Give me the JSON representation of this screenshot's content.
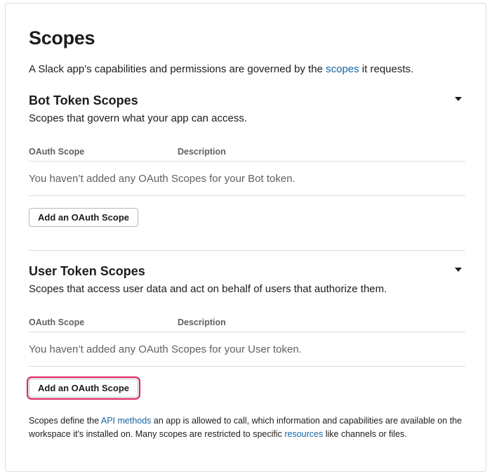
{
  "page": {
    "title": "Scopes",
    "intro_before": "A Slack app's capabilities and permissions are governed by the ",
    "intro_link": "scopes",
    "intro_after": " it requests."
  },
  "bot_section": {
    "title": "Bot Token Scopes",
    "description": "Scopes that govern what your app can access.",
    "col_scope": "OAuth Scope",
    "col_description": "Description",
    "empty_text": "You haven’t added any OAuth Scopes for your Bot token.",
    "add_button": "Add an OAuth Scope",
    "toggle_icon": "caret-down-icon"
  },
  "user_section": {
    "title": "User Token Scopes",
    "description": "Scopes that access user data and act on behalf of users that authorize them.",
    "col_scope": "OAuth Scope",
    "col_description": "Description",
    "empty_text": "You haven’t added any OAuth Scopes for your User token.",
    "add_button": "Add an OAuth Scope",
    "toggle_icon": "caret-down-icon"
  },
  "footer": {
    "text_1": "Scopes define the ",
    "link_1": "API methods",
    "text_2": " an app is allowed to call, which information and capabilities are available on the workspace it's installed on. Many scopes are restricted to specific ",
    "link_2": "resources",
    "text_3": " like channels or files."
  },
  "colors": {
    "link": "#1264a3",
    "highlight": "#e01e5a",
    "border": "#dddddd",
    "muted_text": "#616061"
  }
}
